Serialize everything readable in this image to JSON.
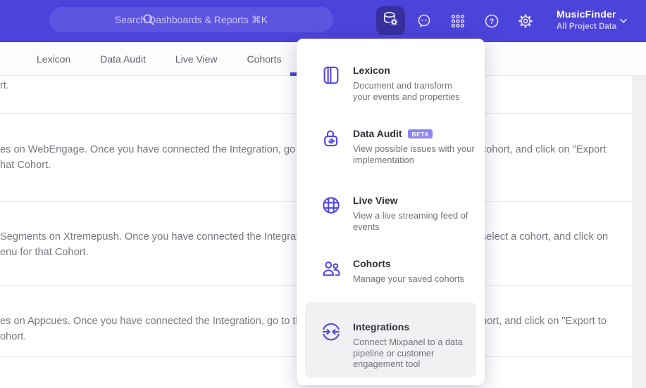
{
  "header": {
    "search_placeholder": "Search Dashboards & Reports ⌘K",
    "project_name": "MusicFinder",
    "project_subtitle": "All Project Data"
  },
  "tabs": [
    {
      "label": "Lexicon"
    },
    {
      "label": "Data Audit"
    },
    {
      "label": "Live View"
    },
    {
      "label": "Cohorts"
    }
  ],
  "menu": {
    "items": [
      {
        "title": "Lexicon",
        "desc": "Document and transform\nyour events and properties"
      },
      {
        "title": "Data Audit",
        "badge": "BETA",
        "desc": "View possible issues with your\nimplementation"
      },
      {
        "title": "Live View",
        "desc": "View a live streaming feed of\nevents"
      },
      {
        "title": "Cohorts",
        "desc": "Manage your saved cohorts"
      },
      {
        "title": "Integrations",
        "desc": "Connect Mixpanel to a data\npipeline or customer\nengagement tool"
      }
    ]
  },
  "content": {
    "rows": [
      {
        "line1": "rt.",
        "line2": "",
        "right": ""
      },
      {
        "line1": "es on WebEngage. Once you have connected the Integration, go to the",
        "line2": "hat Cohort.",
        "right": "cohort, and click on \"Export"
      },
      {
        "line1": "Segments on Xtremepush. Once you have connected the Integration,",
        "line2": "enu for that Cohort.",
        "right": "select a cohort, and click on"
      },
      {
        "line1": "es on Appcues. Once you have connected the Integration, go to the M",
        "line2": "ohort.",
        "right": "hort, and click on \"Export to"
      }
    ]
  },
  "colors": {
    "header_bg": "#4c43da",
    "searchbar_bg": "#5d54e2",
    "active_chip_bg": "#372f9e",
    "accent_purple": "#5247e5",
    "beta_badge_bg": "#8d83f2",
    "menu_highlight_bg": "#f1f1f3",
    "body_text": "#7a7680",
    "divider": "#e8e8ea"
  }
}
